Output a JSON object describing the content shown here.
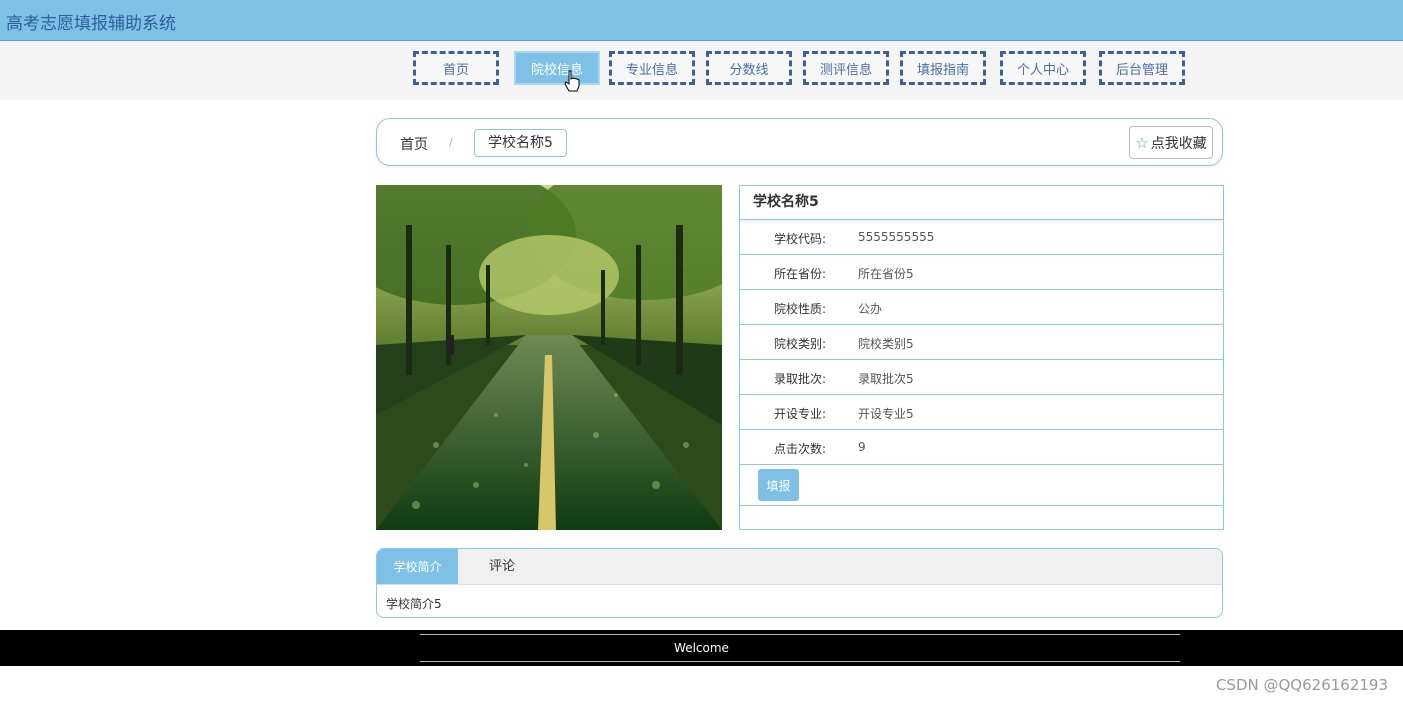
{
  "app": {
    "title": "高考志愿填报辅助系统"
  },
  "nav": {
    "items": [
      {
        "label": "首页"
      },
      {
        "label": "院校信息"
      },
      {
        "label": "专业信息"
      },
      {
        "label": "分数线"
      },
      {
        "label": "测评信息"
      },
      {
        "label": "填报指南"
      },
      {
        "label": "个人中心"
      },
      {
        "label": "后台管理"
      }
    ],
    "active": "院校信息"
  },
  "breadcrumb": {
    "home": "首页",
    "separator": "/",
    "current": "学校名称5"
  },
  "favorite": {
    "label": "点我收藏",
    "icon": "star-icon"
  },
  "school": {
    "name": "学校名称5",
    "fields": [
      {
        "label": "学校代码:",
        "value": "5555555555"
      },
      {
        "label": "所在省份:",
        "value": "所在省份5"
      },
      {
        "label": "院校性质:",
        "value": "公办"
      },
      {
        "label": "院校类别:",
        "value": "院校类别5"
      },
      {
        "label": "录取批次:",
        "value": "录取批次5"
      },
      {
        "label": "开设专业:",
        "value": "开设专业5"
      },
      {
        "label": "点击次数:",
        "value": "9"
      }
    ],
    "apply_label": "填报"
  },
  "tabs": {
    "intro_label": "学校简介",
    "comment_label": "评论",
    "intro_content": "学校简介5"
  },
  "footer": {
    "text": "Welcome"
  },
  "watermark": "CSDN @QQ626162193",
  "colors": {
    "accent": "#7fc1e6",
    "nav_border": "#3d5f9c",
    "panel_border": "#8cc8e6"
  }
}
